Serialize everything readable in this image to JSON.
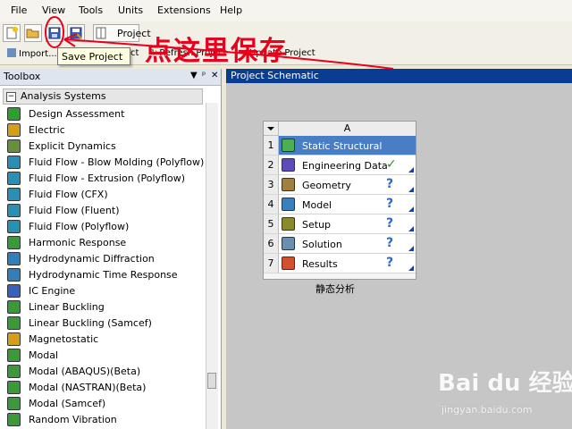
{
  "menu": [
    "File",
    "View",
    "Tools",
    "Units",
    "Extensions",
    "Help"
  ],
  "toolbar": {
    "project_label": "Project"
  },
  "toolbar2": {
    "import_label": "Import...",
    "refresh_label": "Refresh Project",
    "update_label": "Update Project",
    "partial_label": "ct"
  },
  "tooltip": {
    "text": "Save Project"
  },
  "annotation": {
    "text": "点这里保存",
    "color": "#e8001c"
  },
  "toolbox": {
    "title": "Toolbox",
    "pin_symbol": "▼",
    "pin2_symbol": "ᵖ",
    "close_symbol": "✕",
    "section": {
      "toggle": "−",
      "label": "Analysis Systems"
    },
    "items": [
      {
        "label": "Design Assessment",
        "icon": "check-icon",
        "color": "#2e9e2e"
      },
      {
        "label": "Electric",
        "icon": "electric-icon",
        "color": "#d4a017"
      },
      {
        "label": "Explicit Dynamics",
        "icon": "explicit-icon",
        "color": "#6a8f3a"
      },
      {
        "label": "Fluid Flow - Blow Molding (Polyflow)",
        "icon": "fluid-icon",
        "color": "#2a8fb5"
      },
      {
        "label": "Fluid Flow - Extrusion (Polyflow)",
        "icon": "fluid-icon",
        "color": "#2a8fb5"
      },
      {
        "label": "Fluid Flow (CFX)",
        "icon": "fluid-icon",
        "color": "#2a8fb5"
      },
      {
        "label": "Fluid Flow (Fluent)",
        "icon": "fluid-icon",
        "color": "#2a8fb5"
      },
      {
        "label": "Fluid Flow (Polyflow)",
        "icon": "fluid-icon",
        "color": "#2a8fb5"
      },
      {
        "label": "Harmonic Response",
        "icon": "harmonic-icon",
        "color": "#3a9a3a"
      },
      {
        "label": "Hydrodynamic Diffraction",
        "icon": "hydro-icon",
        "color": "#2f7fbf"
      },
      {
        "label": "Hydrodynamic Time Response",
        "icon": "hydro-icon",
        "color": "#2f7fbf"
      },
      {
        "label": "IC Engine",
        "icon": "engine-icon",
        "color": "#3a5fbf"
      },
      {
        "label": "Linear Buckling",
        "icon": "buckling-icon",
        "color": "#3a9a3a"
      },
      {
        "label": "Linear Buckling (Samcef)",
        "icon": "buckling-icon",
        "color": "#3a9a3a"
      },
      {
        "label": "Magnetostatic",
        "icon": "magnet-icon",
        "color": "#d4a017"
      },
      {
        "label": "Modal",
        "icon": "modal-icon",
        "color": "#3a9a3a"
      },
      {
        "label": "Modal (ABAQUS)(Beta)",
        "icon": "modal-icon",
        "color": "#3a9a3a"
      },
      {
        "label": "Modal (NASTRAN)(Beta)",
        "icon": "modal-icon",
        "color": "#3a9a3a"
      },
      {
        "label": "Modal (Samcef)",
        "icon": "modal-icon",
        "color": "#3a9a3a"
      },
      {
        "label": "Random Vibration",
        "icon": "vibration-icon",
        "color": "#3a9a3a"
      }
    ]
  },
  "schematic": {
    "title": "Project Schematic",
    "column": "A",
    "system_name": "静态分析",
    "rows": [
      {
        "num": "1",
        "label": "Static Structural",
        "icon": "static-structural-icon",
        "status": "",
        "selected": true,
        "color": "#4caf50"
      },
      {
        "num": "2",
        "label": "Engineering Data",
        "icon": "engineering-data-icon",
        "status": "✓",
        "selected": false,
        "color": "#5b4db5"
      },
      {
        "num": "3",
        "label": "Geometry",
        "icon": "geometry-icon",
        "status": "?",
        "selected": false,
        "color": "#a08040"
      },
      {
        "num": "4",
        "label": "Model",
        "icon": "model-icon",
        "status": "?",
        "selected": false,
        "color": "#3a7fbf"
      },
      {
        "num": "5",
        "label": "Setup",
        "icon": "setup-icon",
        "status": "?",
        "selected": false,
        "color": "#8a8a2a"
      },
      {
        "num": "6",
        "label": "Solution",
        "icon": "solution-icon",
        "status": "?",
        "selected": false,
        "color": "#6a8faf"
      },
      {
        "num": "7",
        "label": "Results",
        "icon": "results-icon",
        "status": "?",
        "selected": false,
        "color": "#d05030"
      }
    ]
  },
  "watermark": {
    "logo": "Bai du 经验",
    "url": "jingyan.baidu.com"
  }
}
